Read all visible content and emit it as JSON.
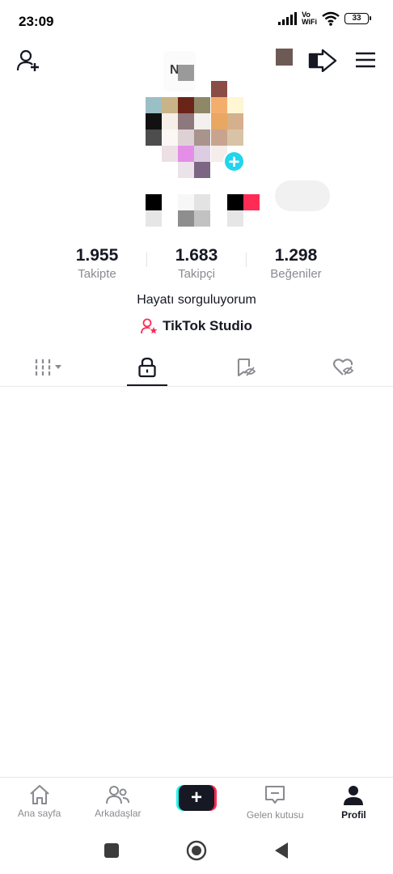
{
  "status_bar": {
    "time": "23:09",
    "network_label_top": "Vo",
    "network_label_bottom": "WiFi",
    "battery": "33",
    "icons": [
      "signal-icon",
      "wifi-icon",
      "battery-icon"
    ]
  },
  "top_bar": {
    "icons": [
      "add-friend-icon",
      "share-icon",
      "menu-icon"
    ],
    "swatch_color": "#6d5a55"
  },
  "profile": {
    "avatar_partial_text": "N",
    "stats": [
      {
        "value": "1.955",
        "label": "Takipte"
      },
      {
        "value": "1.683",
        "label": "Takipçi"
      },
      {
        "value": "1.298",
        "label": "Beğeniler"
      }
    ],
    "bio": "Hayatı sorguluyorum",
    "studio_link": "TikTok Studio"
  },
  "tabs": [
    {
      "icon": "videos-grid-icon",
      "active": false
    },
    {
      "icon": "lock-icon",
      "active": true
    },
    {
      "icon": "hidden-favorites-icon",
      "active": false
    },
    {
      "icon": "liked-hidden-icon",
      "active": false
    }
  ],
  "bottom_nav": [
    {
      "label": "Ana sayfa",
      "icon": "home-icon",
      "active": false
    },
    {
      "label": "Arkadaşlar",
      "icon": "friends-icon",
      "active": false
    },
    {
      "label": "",
      "icon": "create-icon",
      "active": false
    },
    {
      "label": "Gelen kutusu",
      "icon": "inbox-icon",
      "active": false
    },
    {
      "label": "Profil",
      "icon": "profile-icon",
      "active": true
    }
  ],
  "colors": {
    "accent_cyan": "#25f4ee",
    "accent_red": "#fe2c55",
    "text_primary": "#161823",
    "text_secondary": "#8a8b91"
  }
}
